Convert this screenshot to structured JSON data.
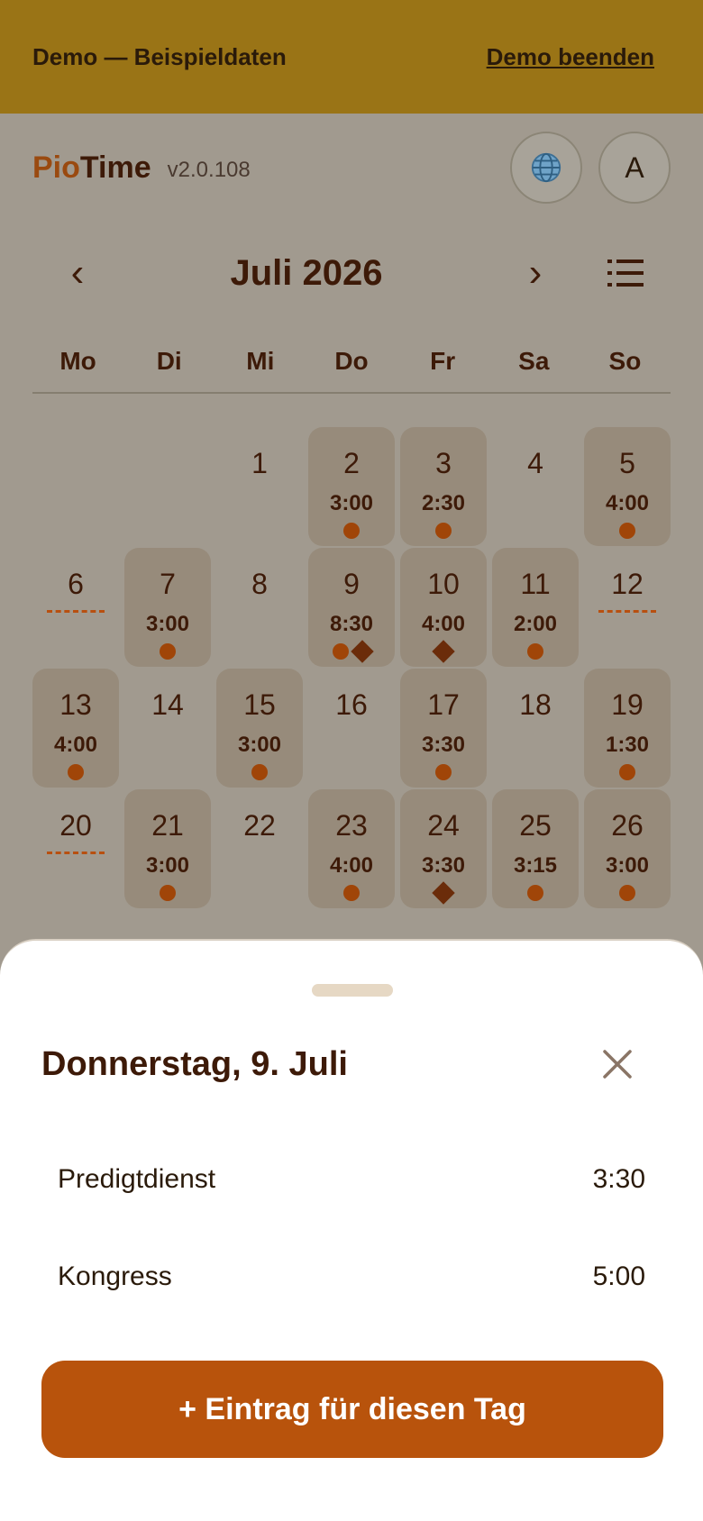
{
  "demo_banner": {
    "text": "Demo — Beispieldaten",
    "exit_label": "Demo beenden"
  },
  "header": {
    "brand_part1": "Pio",
    "brand_part2": "Time",
    "version": "v2.0.108",
    "language_icon": "globe-icon",
    "avatar_letter": "A"
  },
  "calendar": {
    "month_title": "Juli 2026",
    "prev_label": "‹",
    "next_label": "›",
    "weekdays": [
      "Mo",
      "Di",
      "Mi",
      "Do",
      "Fr",
      "Sa",
      "So"
    ],
    "leading_blanks": 2,
    "days": [
      {
        "num": "1"
      },
      {
        "num": "2",
        "time": "3:00",
        "dot": true
      },
      {
        "num": "3",
        "time": "2:30",
        "dot": true
      },
      {
        "num": "4"
      },
      {
        "num": "5",
        "time": "4:00",
        "dot": true
      },
      {
        "num": "6",
        "dashed": true
      },
      {
        "num": "7",
        "time": "3:00",
        "dot": true
      },
      {
        "num": "8"
      },
      {
        "num": "9",
        "time": "8:30",
        "dot": true,
        "diamond": true
      },
      {
        "num": "10",
        "time": "4:00",
        "diamond": true
      },
      {
        "num": "11",
        "time": "2:00",
        "dot": true
      },
      {
        "num": "12",
        "dashed": true
      },
      {
        "num": "13",
        "time": "4:00",
        "dot": true
      },
      {
        "num": "14"
      },
      {
        "num": "15",
        "time": "3:00",
        "dot": true
      },
      {
        "num": "16"
      },
      {
        "num": "17",
        "time": "3:30",
        "dot": true
      },
      {
        "num": "18"
      },
      {
        "num": "19",
        "time": "1:30",
        "dot": true
      },
      {
        "num": "20",
        "dashed": true
      },
      {
        "num": "21",
        "time": "3:00",
        "dot": true
      },
      {
        "num": "22"
      },
      {
        "num": "23",
        "time": "4:00",
        "dot": true
      },
      {
        "num": "24",
        "time": "3:30",
        "diamond": true
      },
      {
        "num": "25",
        "time": "3:15",
        "dot": true
      },
      {
        "num": "26",
        "time": "3:00",
        "dot": true
      }
    ]
  },
  "sheet": {
    "title": "Donnerstag, 9. Juli",
    "entries": [
      {
        "label": "Predigtdienst",
        "time": "3:30"
      },
      {
        "label": "Kongress",
        "time": "5:00"
      }
    ],
    "add_label": "+ Eintrag für diesen Tag"
  },
  "colors": {
    "accent": "#b8530c",
    "banner": "#9a7416",
    "text_dark": "#3d1a08",
    "dot": "#a04508",
    "diamond": "#6b2c0a"
  }
}
